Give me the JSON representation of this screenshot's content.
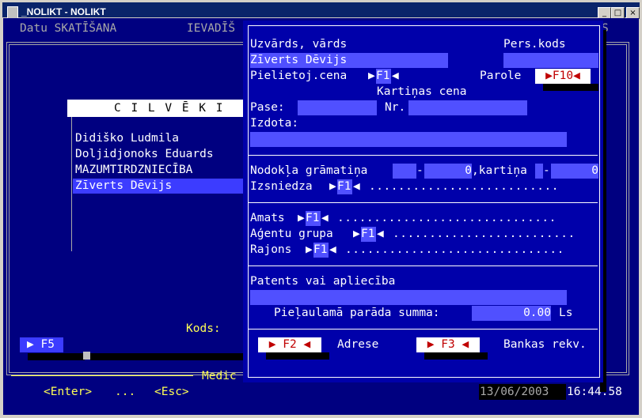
{
  "window": {
    "title": "_NOLIKT - NOLIKT",
    "buttons": {
      "minimize": "_",
      "maximize": "□",
      "close": "×"
    }
  },
  "menu": {
    "item1": "Datu SKATĪŠANA",
    "item2": "IEVADĪŠ",
    "item3": "S"
  },
  "list": {
    "title": "C I L V Ē K I",
    "items": [
      "Didiško Ludmila",
      "Doljidjonoks Eduards",
      "MAZUMTIRDZNIECĪBA",
      "Zīverts Dēvijs"
    ],
    "code_label": "Kods:",
    "f5": "▶ F5"
  },
  "footer": {
    "medic": "Medic",
    "enter": "<Enter>",
    "dots": "...",
    "esc": "<Esc>",
    "date": "13/06/2003",
    "time": "16:44:58"
  },
  "form": {
    "name_label": "Uzvārds, vārds",
    "pers_label": "Pers.kods",
    "name_value": "Zīverts Dēvijs",
    "pers_value": "",
    "price_label": "Pielietoj.cena",
    "f1": "F1",
    "password_label": "Parole",
    "f10": "▶F10◀",
    "card_price_label": "Kartiņas cena",
    "passport_label": "Pase:",
    "nr_label": "Nr.",
    "issued_label": "Izdota:",
    "tax_label": "Nodokļa grāmatiņa",
    "tax_dash1": "-",
    "tax_value": "0",
    "card_label": ",kartiņa",
    "card_dash": "-",
    "card_value": "0",
    "issuer_label": "Izsniedza",
    "position_label": "Amats",
    "agent_label": "Aģentu grupa",
    "region_label": "Rajons",
    "patent_label": "Patents vai apliecība",
    "debt_label": "Pieļaulamā parāda summa:",
    "debt_value": "0.00",
    "currency": "Ls",
    "f2_button": "▶ F2 ◀",
    "address_label": "Adrese",
    "f3_button": "▶ F3 ◀",
    "bank_label": "Bankas rekv."
  }
}
